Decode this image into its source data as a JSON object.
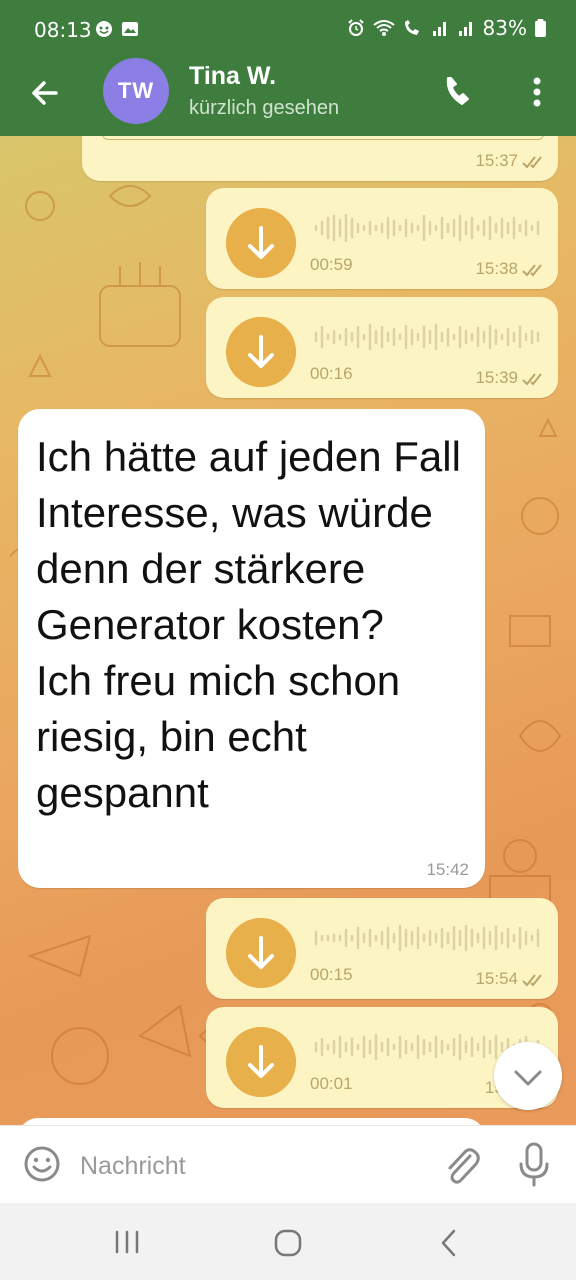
{
  "status_bar": {
    "time": "08:13",
    "battery": "83%"
  },
  "header": {
    "back_icon": "arrow-left-icon",
    "avatar_initials": "TW",
    "avatar_color": "#8b7fe6",
    "contact_name": "Tina W.",
    "contact_status": "kürzlich gesehen",
    "call_icon": "phone-icon",
    "menu_icon": "more-vert-icon"
  },
  "messages": [
    {
      "type": "outgoing",
      "time": "15:37",
      "status": "read"
    },
    {
      "type": "outgoing-voice",
      "duration": "00:59",
      "time": "15:38",
      "status": "read"
    },
    {
      "type": "outgoing-voice",
      "duration": "00:16",
      "time": "15:39",
      "status": "read"
    },
    {
      "type": "incoming-text",
      "text": "Ich hätte auf jeden Fall Interesse, was würde denn der stärkere Generator kosten?\nIch freu mich schon riesig, bin echt gespannt",
      "time": "15:42"
    },
    {
      "type": "outgoing-voice",
      "duration": "00:15",
      "time": "15:54",
      "status": "read"
    },
    {
      "type": "outgoing-voice",
      "duration": "00:01",
      "time": "15:5",
      "status": "read"
    }
  ],
  "input": {
    "placeholder": "Nachricht",
    "value": ""
  },
  "colors": {
    "header": "#3f7d3f",
    "outgoing_bubble": "#fdf4c4",
    "download_button": "#e8b04a"
  }
}
